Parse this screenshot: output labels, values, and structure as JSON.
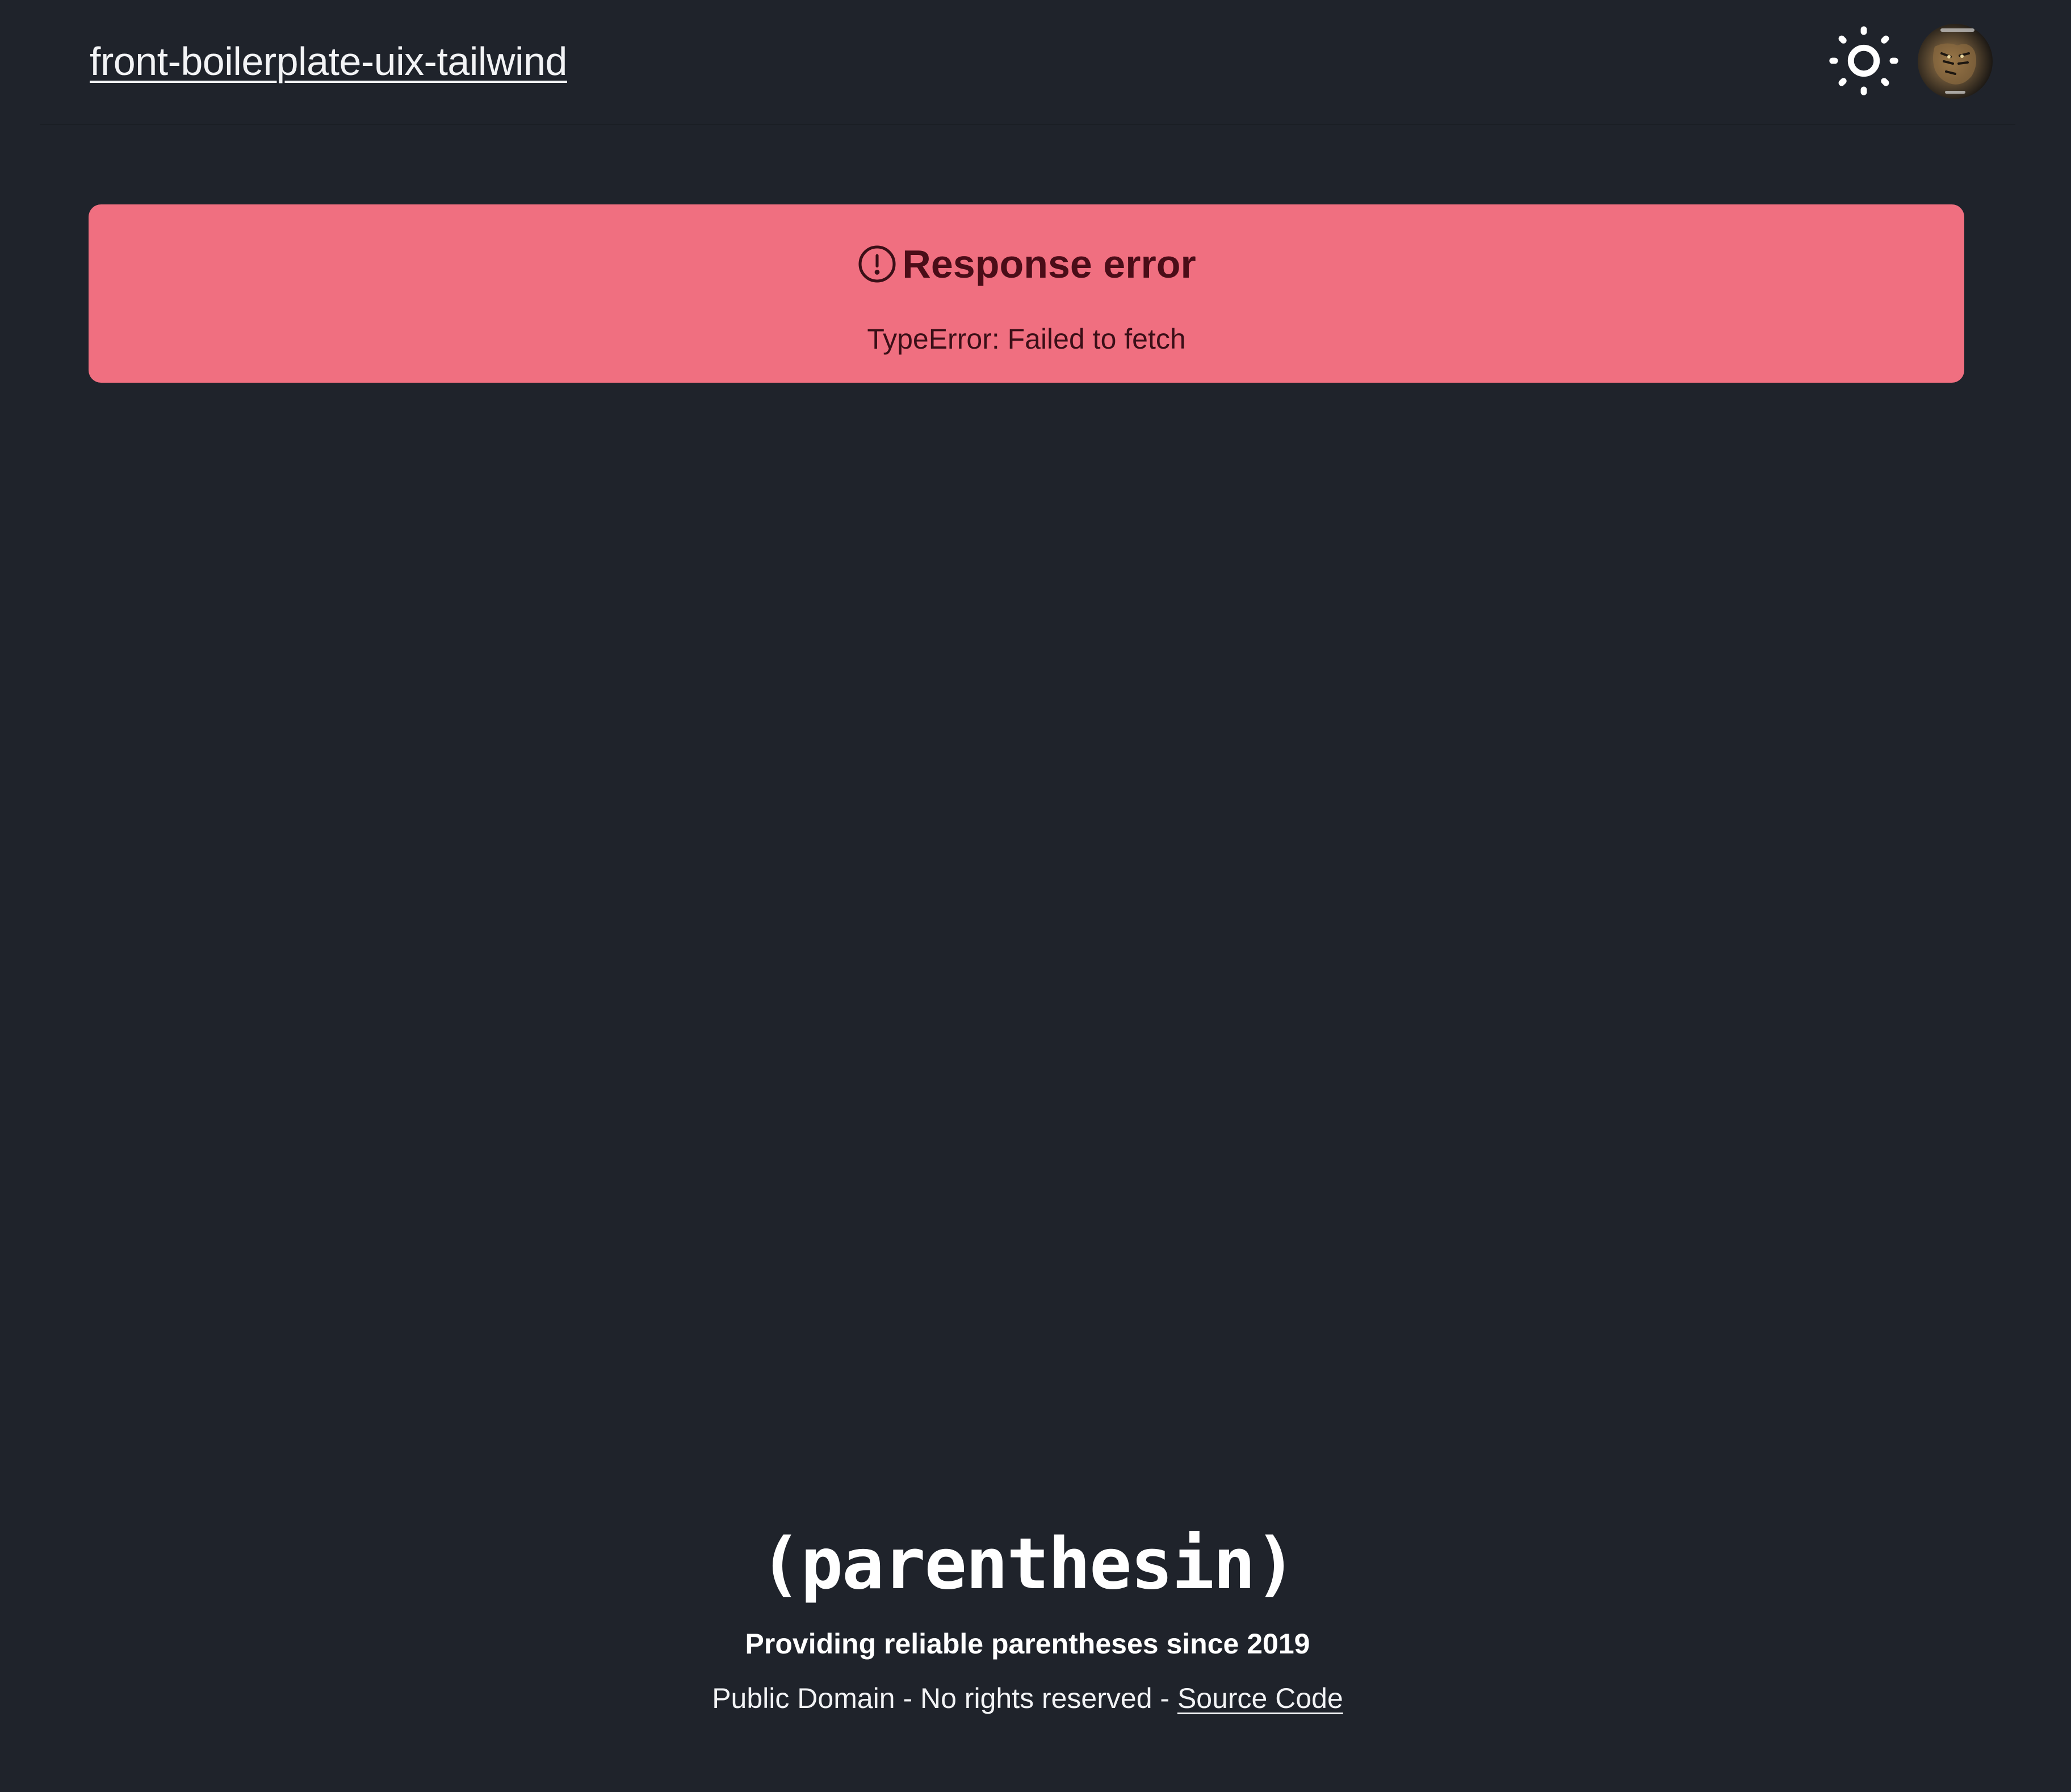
{
  "header": {
    "brand": "front-boilerplate-uix-tailwind",
    "theme_toggle_icon": "sun-icon",
    "avatar_icon": "user-avatar-image"
  },
  "alert": {
    "icon": "alert-circle-icon",
    "title": "Response error",
    "message": "TypeError: Failed to fetch",
    "background_color": "#f06f80",
    "text_color": "#4a0d18"
  },
  "footer": {
    "logo": "(parenthesin)",
    "tagline": "Providing reliable parentheses since 2019",
    "copyright": "Public Domain - No rights reserved - ",
    "source_link": "Source Code"
  },
  "colors": {
    "background": "#1f232b",
    "text": "#f2f3f5"
  }
}
